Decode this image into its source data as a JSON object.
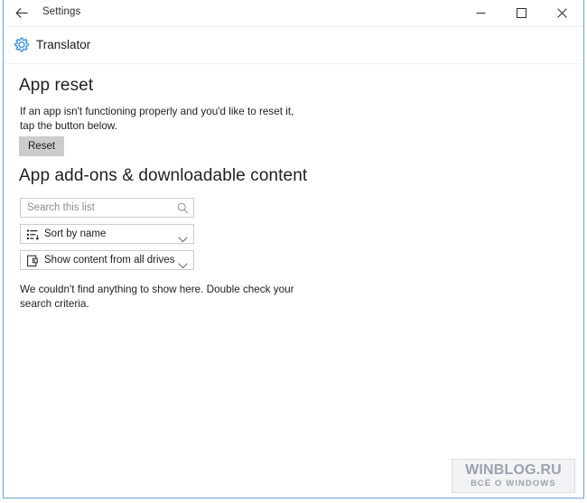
{
  "window": {
    "titlebar": {
      "title": "Settings",
      "back_icon": "back-arrow-icon",
      "minimize_icon": "minimize-icon",
      "maximize_icon": "maximize-icon",
      "close_icon": "close-icon"
    },
    "border_color": "#6ba5d7"
  },
  "app_header": {
    "icon": "gear-icon",
    "icon_color": "#4a9ae0",
    "name": "Translator"
  },
  "sections": {
    "app_reset": {
      "title": "App reset",
      "description": "If an app isn't functioning properly and you'd like to reset it, tap the button below.",
      "reset_button_label": "Reset"
    },
    "addons": {
      "title": "App add-ons & downloadable content",
      "search": {
        "placeholder": "Search this list",
        "value": "",
        "icon": "search-icon"
      },
      "sort_dropdown": {
        "label": "Sort by name",
        "icon": "sort-list-icon",
        "chevron": "chevron-down-icon"
      },
      "drives_dropdown": {
        "label": "Show content from all drives",
        "icon": "drive-icon",
        "chevron": "chevron-down-icon"
      },
      "empty_message": "We couldn't find anything to show here. Double check your search criteria."
    }
  },
  "watermark": {
    "line1": "WINBLOG.RU",
    "line2": "ВСЁ О WINDOWS"
  }
}
